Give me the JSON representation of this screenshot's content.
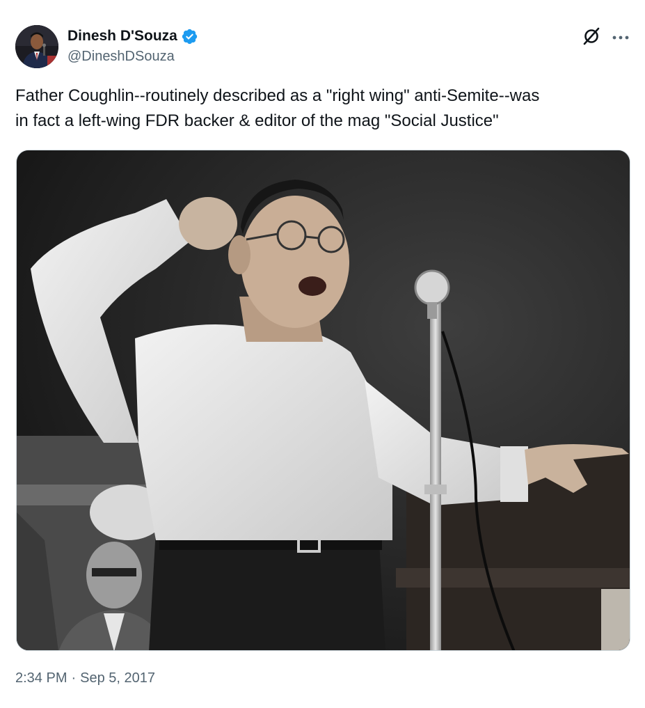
{
  "author": {
    "display_name": "Dinesh D'Souza",
    "handle": "@DineshDSouza",
    "verified": true
  },
  "icons": {
    "verified": "verified-badge-icon",
    "grok": "grok-icon",
    "more": "more-horizontal-icon"
  },
  "tweet": {
    "text": "Father Coughlin--routinely described as a \"right wing\" anti-Semite--was\nin fact a left-wing FDR backer & editor of the mag \"Social Justice\""
  },
  "meta": {
    "time": "2:34 PM",
    "separator": "·",
    "date": "Sep 5, 2017"
  },
  "colors": {
    "text": "#0f1419",
    "secondary": "#536471",
    "verified": "#1d9bf0"
  }
}
